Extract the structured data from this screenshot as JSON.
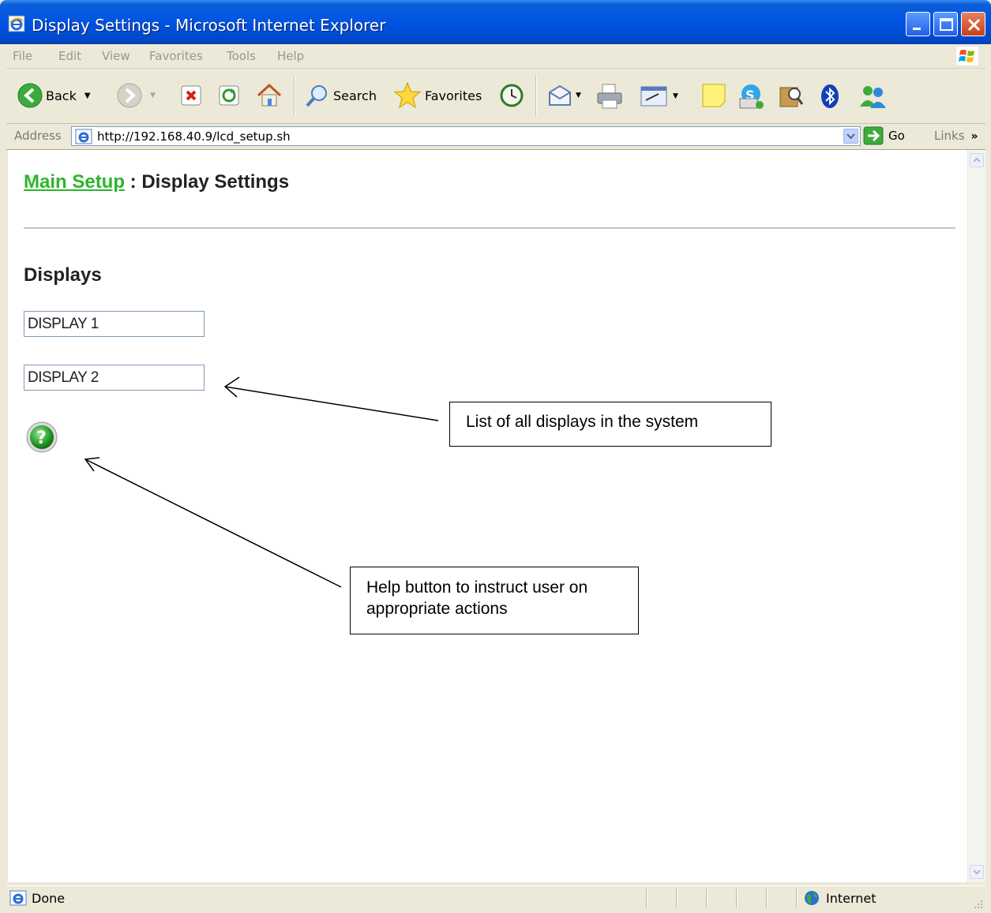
{
  "window": {
    "title": "Display Settings - Microsoft Internet Explorer"
  },
  "menu": [
    "File",
    "Edit",
    "View",
    "Favorites",
    "Tools",
    "Help"
  ],
  "toolbar": {
    "back": "Back",
    "search": "Search",
    "favorites": "Favorites"
  },
  "address": {
    "label": "Address",
    "url": "http://192.168.40.9/lcd_setup.sh",
    "go": "Go",
    "links": "Links"
  },
  "page": {
    "breadcrumb_link": "Main Setup",
    "breadcrumb_sep": " : ",
    "breadcrumb_current": "Display Settings",
    "section_title": "Displays",
    "displays": [
      "DISPLAY 1",
      "DISPLAY 2"
    ]
  },
  "callouts": {
    "displays_note": "List of all displays in the system",
    "help_note": "Help button to instruct user on appropriate actions"
  },
  "status": {
    "text": "Done",
    "zone": "Internet"
  },
  "colors": {
    "link": "#2db52d",
    "titlebar": "#0054e3",
    "chrome": "#ece9d8"
  }
}
